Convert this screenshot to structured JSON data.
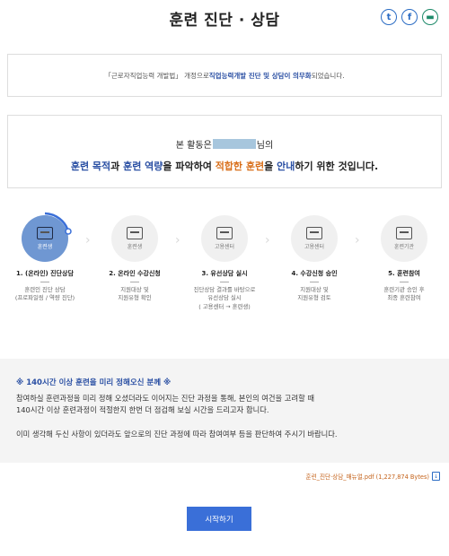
{
  "header": {
    "title": "훈련 진단 · 상담",
    "share": [
      {
        "name": "twitter-share",
        "glyph": "t"
      },
      {
        "name": "facebook-share",
        "glyph": "f"
      },
      {
        "name": "kakaotalk-share",
        "glyph": "▬"
      }
    ]
  },
  "notice": {
    "prefix": "「근로자직업능력 개발법」 개정으로 ",
    "highlight": "직업능력개발 진단 및 상담이 의무화",
    "suffix": " 되었습니다."
  },
  "intro": {
    "line1_prefix": "본 활동은",
    "line1_suffix": "님의",
    "line2": {
      "p1": "훈련 목적",
      "p2": "과 ",
      "p3": "훈련 역량",
      "p4": "을 파악하여 ",
      "p5": "적합한 훈련",
      "p6": "을 ",
      "p7": "안내",
      "p8": "하기 위한 것입니다."
    }
  },
  "steps": [
    {
      "role": "훈련생",
      "title": "1. (온라인) 진단상담",
      "desc": [
        "훈련인 진단 상담",
        "(프로파일링 / 역량 진단)"
      ],
      "active": true
    },
    {
      "role": "훈련생",
      "title": "2. 온라인 수강신청",
      "desc": [
        "지원대상 및",
        "지원유형 확인"
      ],
      "active": false
    },
    {
      "role": "고용센터",
      "title": "3. 유선상담 실시",
      "desc": [
        "진단상담 결과를 바탕으로",
        "유선상담 실시",
        "( 고용센터 → 훈련생)"
      ],
      "active": false
    },
    {
      "role": "고용센터",
      "title": "4. 수강신청 승인",
      "desc": [
        "지원대상 및",
        "지원유형 검토"
      ],
      "active": false
    },
    {
      "role": "훈련기관",
      "title": "5. 훈련참여",
      "desc": [
        "훈련기관 승인 후",
        "최종 훈련참여"
      ],
      "active": false
    }
  ],
  "info": {
    "title": "※ 140시간 이상 훈련을 미리 정해오신 분께 ※",
    "line1": "참여하실 훈련과정을 미리 정해 오셨더라도 이어지는 진단 과정을 통해, 본인의 여건을 고려할 때",
    "line2": "140시간 이상 훈련과정이 적절한지 한번 더 점검해 보실 시간을 드리고자 합니다.",
    "line3": "이미 생각해 두신 사항이 있더라도 앞으로의 진단 과정에 따라 참여여부 등을 판단하여 주시기 바랍니다."
  },
  "download": {
    "label": "훈련_진단·상담_매뉴얼.pdf (1,227,874 Bytes)"
  },
  "start_button": "시작하기"
}
